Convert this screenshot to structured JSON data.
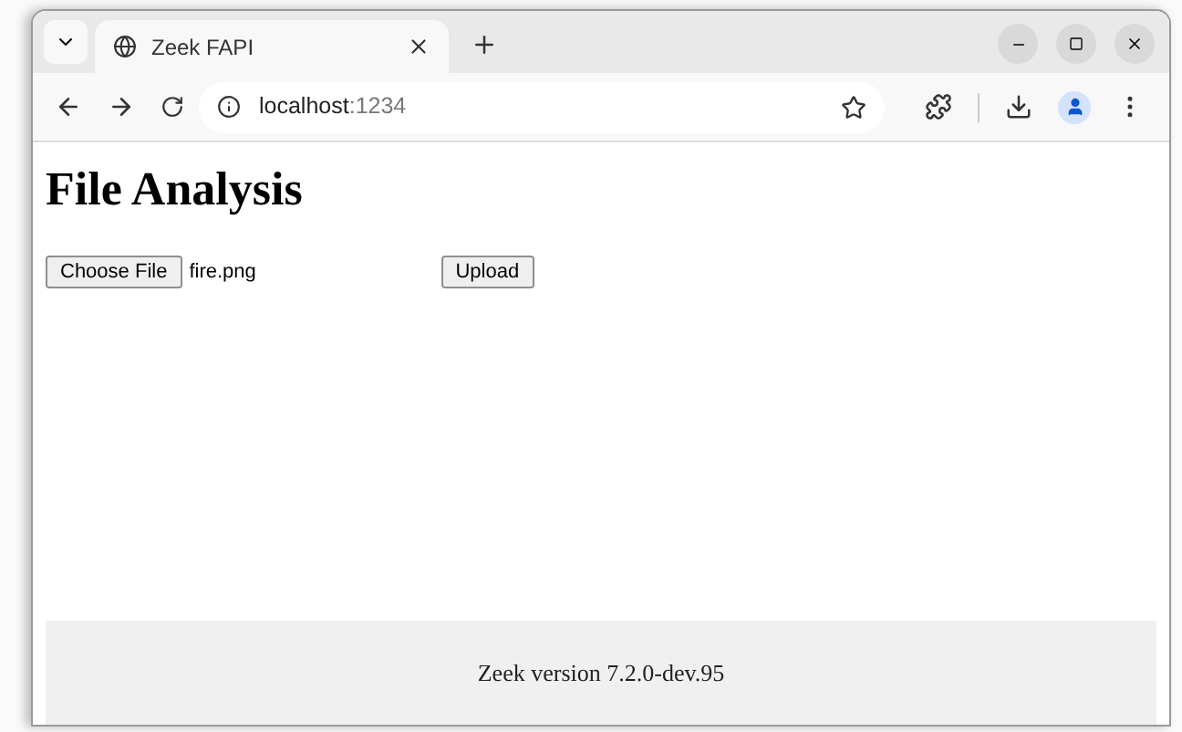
{
  "browser": {
    "tab": {
      "title": "Zeek FAPI",
      "selected": true
    },
    "url_host": "localhost",
    "url_port": ":1234"
  },
  "page": {
    "heading": "File Analysis",
    "file_button": "Choose File",
    "file_name": "fire.png",
    "upload_button": "Upload",
    "footer": "Zeek version 7.2.0-dev.95"
  }
}
